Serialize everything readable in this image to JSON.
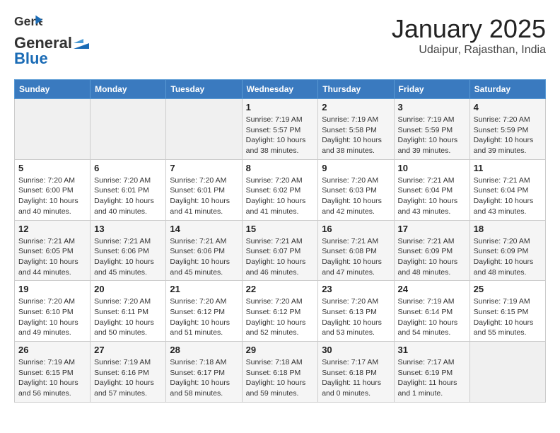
{
  "logo": {
    "general": "General",
    "blue": "Blue"
  },
  "title": "January 2025",
  "location": "Udaipur, Rajasthan, India",
  "weekdays": [
    "Sunday",
    "Monday",
    "Tuesday",
    "Wednesday",
    "Thursday",
    "Friday",
    "Saturday"
  ],
  "weeks": [
    [
      {
        "day": "",
        "sunrise": "",
        "sunset": "",
        "daylight": ""
      },
      {
        "day": "",
        "sunrise": "",
        "sunset": "",
        "daylight": ""
      },
      {
        "day": "",
        "sunrise": "",
        "sunset": "",
        "daylight": ""
      },
      {
        "day": "1",
        "sunrise": "Sunrise: 7:19 AM",
        "sunset": "Sunset: 5:57 PM",
        "daylight": "Daylight: 10 hours and 38 minutes."
      },
      {
        "day": "2",
        "sunrise": "Sunrise: 7:19 AM",
        "sunset": "Sunset: 5:58 PM",
        "daylight": "Daylight: 10 hours and 38 minutes."
      },
      {
        "day": "3",
        "sunrise": "Sunrise: 7:19 AM",
        "sunset": "Sunset: 5:59 PM",
        "daylight": "Daylight: 10 hours and 39 minutes."
      },
      {
        "day": "4",
        "sunrise": "Sunrise: 7:20 AM",
        "sunset": "Sunset: 5:59 PM",
        "daylight": "Daylight: 10 hours and 39 minutes."
      }
    ],
    [
      {
        "day": "5",
        "sunrise": "Sunrise: 7:20 AM",
        "sunset": "Sunset: 6:00 PM",
        "daylight": "Daylight: 10 hours and 40 minutes."
      },
      {
        "day": "6",
        "sunrise": "Sunrise: 7:20 AM",
        "sunset": "Sunset: 6:01 PM",
        "daylight": "Daylight: 10 hours and 40 minutes."
      },
      {
        "day": "7",
        "sunrise": "Sunrise: 7:20 AM",
        "sunset": "Sunset: 6:01 PM",
        "daylight": "Daylight: 10 hours and 41 minutes."
      },
      {
        "day": "8",
        "sunrise": "Sunrise: 7:20 AM",
        "sunset": "Sunset: 6:02 PM",
        "daylight": "Daylight: 10 hours and 41 minutes."
      },
      {
        "day": "9",
        "sunrise": "Sunrise: 7:20 AM",
        "sunset": "Sunset: 6:03 PM",
        "daylight": "Daylight: 10 hours and 42 minutes."
      },
      {
        "day": "10",
        "sunrise": "Sunrise: 7:21 AM",
        "sunset": "Sunset: 6:04 PM",
        "daylight": "Daylight: 10 hours and 43 minutes."
      },
      {
        "day": "11",
        "sunrise": "Sunrise: 7:21 AM",
        "sunset": "Sunset: 6:04 PM",
        "daylight": "Daylight: 10 hours and 43 minutes."
      }
    ],
    [
      {
        "day": "12",
        "sunrise": "Sunrise: 7:21 AM",
        "sunset": "Sunset: 6:05 PM",
        "daylight": "Daylight: 10 hours and 44 minutes."
      },
      {
        "day": "13",
        "sunrise": "Sunrise: 7:21 AM",
        "sunset": "Sunset: 6:06 PM",
        "daylight": "Daylight: 10 hours and 45 minutes."
      },
      {
        "day": "14",
        "sunrise": "Sunrise: 7:21 AM",
        "sunset": "Sunset: 6:06 PM",
        "daylight": "Daylight: 10 hours and 45 minutes."
      },
      {
        "day": "15",
        "sunrise": "Sunrise: 7:21 AM",
        "sunset": "Sunset: 6:07 PM",
        "daylight": "Daylight: 10 hours and 46 minutes."
      },
      {
        "day": "16",
        "sunrise": "Sunrise: 7:21 AM",
        "sunset": "Sunset: 6:08 PM",
        "daylight": "Daylight: 10 hours and 47 minutes."
      },
      {
        "day": "17",
        "sunrise": "Sunrise: 7:21 AM",
        "sunset": "Sunset: 6:09 PM",
        "daylight": "Daylight: 10 hours and 48 minutes."
      },
      {
        "day": "18",
        "sunrise": "Sunrise: 7:20 AM",
        "sunset": "Sunset: 6:09 PM",
        "daylight": "Daylight: 10 hours and 48 minutes."
      }
    ],
    [
      {
        "day": "19",
        "sunrise": "Sunrise: 7:20 AM",
        "sunset": "Sunset: 6:10 PM",
        "daylight": "Daylight: 10 hours and 49 minutes."
      },
      {
        "day": "20",
        "sunrise": "Sunrise: 7:20 AM",
        "sunset": "Sunset: 6:11 PM",
        "daylight": "Daylight: 10 hours and 50 minutes."
      },
      {
        "day": "21",
        "sunrise": "Sunrise: 7:20 AM",
        "sunset": "Sunset: 6:12 PM",
        "daylight": "Daylight: 10 hours and 51 minutes."
      },
      {
        "day": "22",
        "sunrise": "Sunrise: 7:20 AM",
        "sunset": "Sunset: 6:12 PM",
        "daylight": "Daylight: 10 hours and 52 minutes."
      },
      {
        "day": "23",
        "sunrise": "Sunrise: 7:20 AM",
        "sunset": "Sunset: 6:13 PM",
        "daylight": "Daylight: 10 hours and 53 minutes."
      },
      {
        "day": "24",
        "sunrise": "Sunrise: 7:19 AM",
        "sunset": "Sunset: 6:14 PM",
        "daylight": "Daylight: 10 hours and 54 minutes."
      },
      {
        "day": "25",
        "sunrise": "Sunrise: 7:19 AM",
        "sunset": "Sunset: 6:15 PM",
        "daylight": "Daylight: 10 hours and 55 minutes."
      }
    ],
    [
      {
        "day": "26",
        "sunrise": "Sunrise: 7:19 AM",
        "sunset": "Sunset: 6:15 PM",
        "daylight": "Daylight: 10 hours and 56 minutes."
      },
      {
        "day": "27",
        "sunrise": "Sunrise: 7:19 AM",
        "sunset": "Sunset: 6:16 PM",
        "daylight": "Daylight: 10 hours and 57 minutes."
      },
      {
        "day": "28",
        "sunrise": "Sunrise: 7:18 AM",
        "sunset": "Sunset: 6:17 PM",
        "daylight": "Daylight: 10 hours and 58 minutes."
      },
      {
        "day": "29",
        "sunrise": "Sunrise: 7:18 AM",
        "sunset": "Sunset: 6:18 PM",
        "daylight": "Daylight: 10 hours and 59 minutes."
      },
      {
        "day": "30",
        "sunrise": "Sunrise: 7:17 AM",
        "sunset": "Sunset: 6:18 PM",
        "daylight": "Daylight: 11 hours and 0 minutes."
      },
      {
        "day": "31",
        "sunrise": "Sunrise: 7:17 AM",
        "sunset": "Sunset: 6:19 PM",
        "daylight": "Daylight: 11 hours and 1 minute."
      },
      {
        "day": "",
        "sunrise": "",
        "sunset": "",
        "daylight": ""
      }
    ]
  ]
}
